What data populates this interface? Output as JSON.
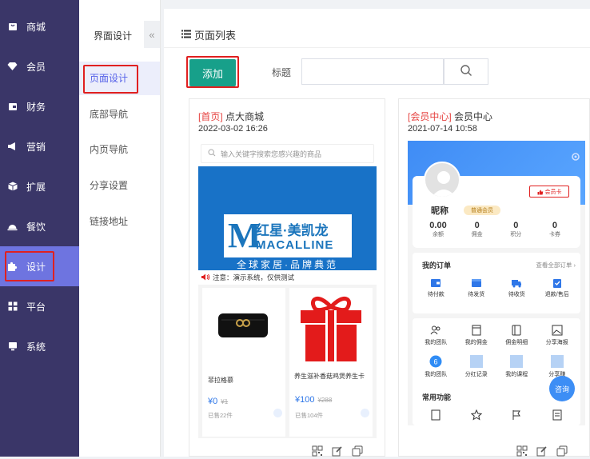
{
  "sidebar": {
    "items": [
      {
        "label": "商城",
        "icon": "mall-icon"
      },
      {
        "label": "会员",
        "icon": "diamond-icon"
      },
      {
        "label": "财务",
        "icon": "wallet-icon"
      },
      {
        "label": "营销",
        "icon": "megaphone-icon"
      },
      {
        "label": "扩展",
        "icon": "cube-icon"
      },
      {
        "label": "餐饮",
        "icon": "cloche-icon"
      },
      {
        "label": "设计",
        "icon": "puzzle-icon"
      },
      {
        "label": "平台",
        "icon": "grid-icon"
      },
      {
        "label": "系统",
        "icon": "monitor-icon"
      }
    ],
    "active_index": 6,
    "colors": {
      "background": "#3a3668",
      "active": "#6e74e0"
    }
  },
  "subnav": {
    "title": "界面设计",
    "collapse_glyph": "«",
    "items": [
      "页面设计",
      "底部导航",
      "内页导航",
      "分享设置",
      "链接地址"
    ],
    "active_index": 0
  },
  "main": {
    "heading": "页面列表",
    "add_label": "添加",
    "title_label": "标题",
    "search_value": "",
    "accent_color": "#17a08a"
  },
  "cards": [
    {
      "tag": "[首页]",
      "name": "点大商城",
      "date": "2022-03-02 16:26",
      "preview": {
        "search_placeholder": "输入关键字搜索您感兴趣的商品",
        "banner_logo_letter": "M",
        "banner_cn": "红星·美凯龙",
        "banner_en": "MACALLINE",
        "banner_slogan": "全球家居·品牌典范",
        "notice": "注意：演示系统，仅供测试",
        "products": [
          {
            "name": "菲拉格慕",
            "price": "¥0",
            "old_price": "¥1",
            "sold": "已售22件"
          },
          {
            "name": "养生滋补香菇鸡煲养生卡",
            "price": "¥100",
            "old_price": "¥288",
            "sold": "已售104件"
          }
        ]
      }
    },
    {
      "tag": "[会员中心]",
      "name": "会员中心",
      "date": "2021-07-14 10:58",
      "preview": {
        "member_card": "会员卡",
        "nickname": "昵称",
        "level": "普通会员",
        "stats": [
          {
            "value": "0.00",
            "label": "余额"
          },
          {
            "value": "0",
            "label": "佣金"
          },
          {
            "value": "0",
            "label": "积分"
          },
          {
            "value": "0",
            "label": "卡券"
          }
        ],
        "orders_title": "我的订单",
        "orders_more": "查看全部订单",
        "orders": [
          "待付款",
          "待发货",
          "待收货",
          "退款/售后"
        ],
        "tools_row1": [
          "我的团队",
          "我的佣金",
          "佣金明细",
          "分享海报"
        ],
        "tools_row2": [
          "我的团队",
          "分红记录",
          "我的课程",
          "分享赚"
        ],
        "common_title": "常用功能",
        "float_label": "咨询"
      }
    }
  ]
}
